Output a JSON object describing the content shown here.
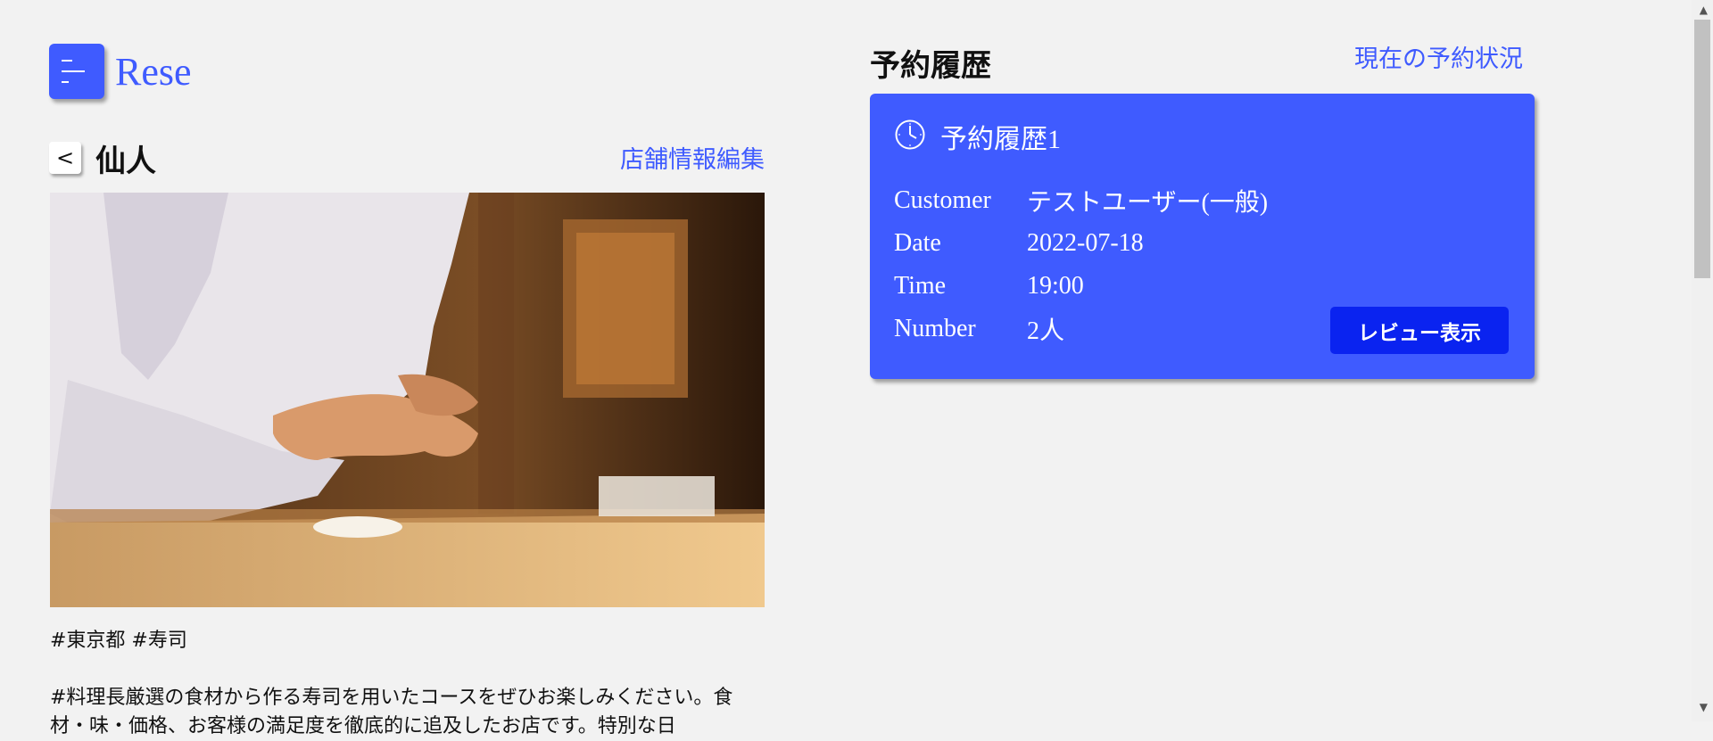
{
  "header": {
    "brand": "Rese",
    "menu_icon": "menu-icon"
  },
  "shop": {
    "back_label": "<",
    "name": "仙人",
    "edit_link": "店舗情報編集",
    "tags": "#東京都 #寿司",
    "description": "#料理長厳選の食材から作る寿司を用いたコースをぜひお楽しみください。食材・味・価格、お客様の満足度を徹底的に追及したお店です。特別な日"
  },
  "history": {
    "title": "予約履歴",
    "current_link": "現在の予約状況",
    "card": {
      "icon": "clock-icon",
      "title": "予約履歴1",
      "rows": [
        {
          "key": "Customer",
          "value": "テストユーザー(一般)"
        },
        {
          "key": "Date",
          "value": "2022-07-18"
        },
        {
          "key": "Time",
          "value": "19:00"
        },
        {
          "key": "Number",
          "value": "2人"
        }
      ],
      "review_button": "レビュー表示"
    }
  },
  "colors": {
    "accent": "#3f5bff",
    "button": "#0a23f0",
    "background": "#f2f2f2"
  }
}
